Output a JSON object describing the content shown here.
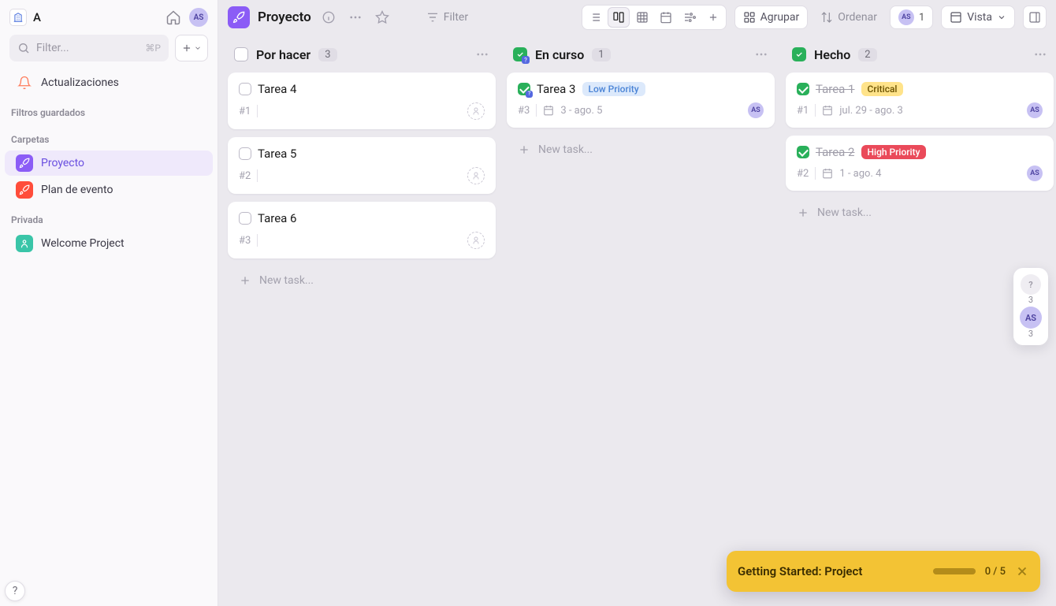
{
  "workspace": {
    "name": "A"
  },
  "user": {
    "initials": "AS"
  },
  "sidebar": {
    "filter_placeholder": "Filter...",
    "filter_shortcut": "⌘P",
    "updates_label": "Actualizaciones",
    "section_saved_filters": "Filtros guardados",
    "section_folders": "Carpetas",
    "section_private": "Privada",
    "folders": [
      {
        "label": "Proyecto",
        "color": "#8b5cf6",
        "active": true
      },
      {
        "label": "Plan de evento",
        "color": "#ff4d3a",
        "active": false
      }
    ],
    "private": [
      {
        "label": "Welcome Project",
        "color": "#3ac5a8"
      }
    ]
  },
  "topbar": {
    "project_title": "Proyecto",
    "filter_label": "Filter",
    "group_label": "Agrupar",
    "sort_label": "Ordenar",
    "assignee_count": "1",
    "view_label": "Vista"
  },
  "board": {
    "new_task_label": "New task...",
    "columns": [
      {
        "status": "todo",
        "title": "Por hacer",
        "count": "3",
        "tasks": [
          {
            "title": "Tarea 4",
            "id": "#1",
            "done": false
          },
          {
            "title": "Tarea 5",
            "id": "#2",
            "done": false
          },
          {
            "title": "Tarea 6",
            "id": "#3",
            "done": false
          }
        ]
      },
      {
        "status": "inprogress",
        "title": "En curso",
        "count": "1",
        "tasks": [
          {
            "title": "Tarea 3",
            "id": "#3",
            "done": false,
            "priority": "Low Priority",
            "priority_cls": "prio-low",
            "dates": "3 - ago. 5",
            "assignee": "AS"
          }
        ]
      },
      {
        "status": "done",
        "title": "Hecho",
        "count": "2",
        "tasks": [
          {
            "title": "Tarea 1",
            "id": "#1",
            "done": true,
            "priority": "Critical",
            "priority_cls": "prio-critical",
            "dates": "jul. 29 - ago. 3",
            "assignee": "AS"
          },
          {
            "title": "Tarea 2",
            "id": "#2",
            "done": true,
            "priority": "High Priority",
            "priority_cls": "prio-high",
            "dates": "1 - ago. 4",
            "assignee": "AS"
          }
        ]
      }
    ]
  },
  "floater": {
    "unknown_count": "3",
    "user_count": "3"
  },
  "toast": {
    "title": "Getting Started: Project",
    "progress_text": "0 / 5"
  }
}
